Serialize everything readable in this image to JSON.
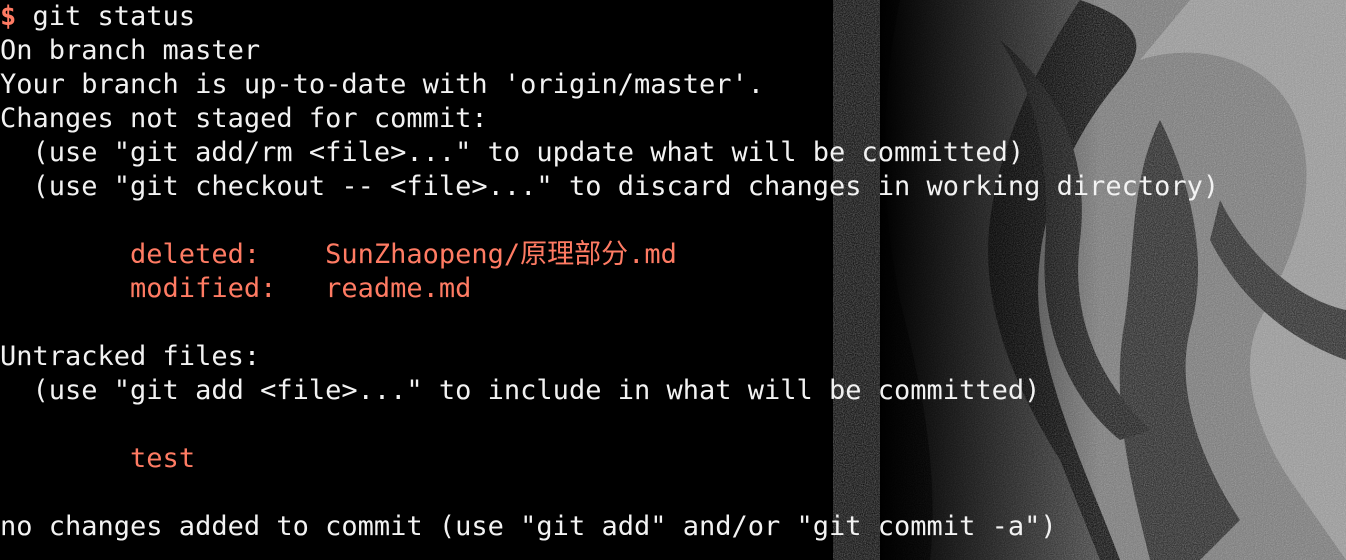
{
  "terminal": {
    "prompt_symbol": "$",
    "command": " git status",
    "lines": {
      "branch": "On branch master",
      "uptodate": "Your branch is up-to-date with 'origin/master'.",
      "changes_header": "Changes not staged for commit:",
      "hint_add_rm": "  (use \"git add/rm <file>...\" to update what will be committed)",
      "hint_checkout": "  (use \"git checkout -- <file>...\" to discard changes in working directory)",
      "untracked_header": "Untracked files:",
      "hint_add": "  (use \"git add <file>...\" to include in what will be committed)",
      "footer": "no changes added to commit (use \"git add\" and/or \"git commit -a\")"
    },
    "changed_files": [
      {
        "status": "        deleted:    ",
        "path": "SunZhaopeng/原理部分.md"
      },
      {
        "status": "        modified:   ",
        "path": "readme.md"
      }
    ],
    "untracked_files": [
      {
        "indent": "        ",
        "path": "test"
      }
    ]
  },
  "colors": {
    "background": "#000000",
    "text": "#f2f2f2",
    "highlight": "#ff7b63"
  }
}
